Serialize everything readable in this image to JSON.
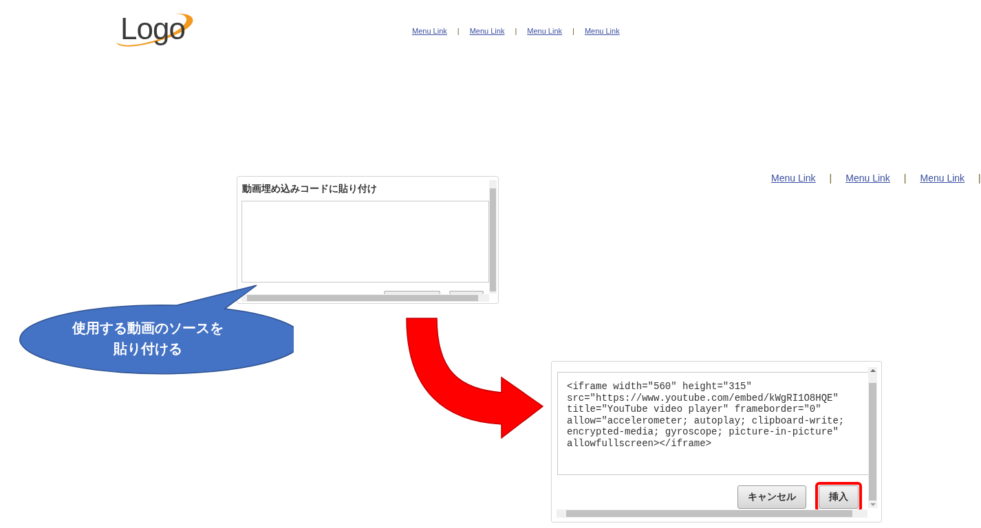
{
  "header": {
    "logo": "Logo",
    "items": [
      {
        "kind": "link",
        "text": "Menu Link"
      },
      {
        "kind": "separator",
        "text": "|"
      },
      {
        "kind": "link",
        "text": "Menu Link"
      },
      {
        "kind": "separator",
        "text": "|"
      },
      {
        "kind": "link",
        "text": "Menu Link"
      },
      {
        "kind": "separator",
        "text": "|"
      },
      {
        "kind": "link",
        "text": "Menu Link"
      }
    ]
  },
  "nav_zoomed": {
    "items": [
      {
        "kind": "link",
        "text": "Menu Link"
      },
      {
        "kind": "separator",
        "text": "|"
      },
      {
        "kind": "link",
        "text": "Menu Link"
      },
      {
        "kind": "separator",
        "text": "|"
      },
      {
        "kind": "link",
        "text": "Menu Link"
      },
      {
        "kind": "separator",
        "text": "|"
      }
    ]
  },
  "empty_dialog": {
    "title": "動画埋め込みコードに貼り付け"
  },
  "callout": {
    "lines": [
      "使用する動画のソースを",
      "貼り付ける"
    ]
  },
  "filled_dialog": {
    "code_lines": [
      "<iframe width=\"560\" height=\"315\"",
      "src=\"https://www.youtube.com/embed/kWgRI1O8HQE\"",
      "title=\"YouTube video player\" frameborder=\"0\"",
      "allow=\"accelerometer; autoplay; clipboard-write;",
      "encrypted-media; gyroscope; picture-in-picture\"",
      "allowfullscreen></iframe>"
    ],
    "buttons": [
      {
        "label": "キャンセル",
        "highlighted": false
      },
      {
        "label": "挿入",
        "highlighted": true
      }
    ]
  }
}
